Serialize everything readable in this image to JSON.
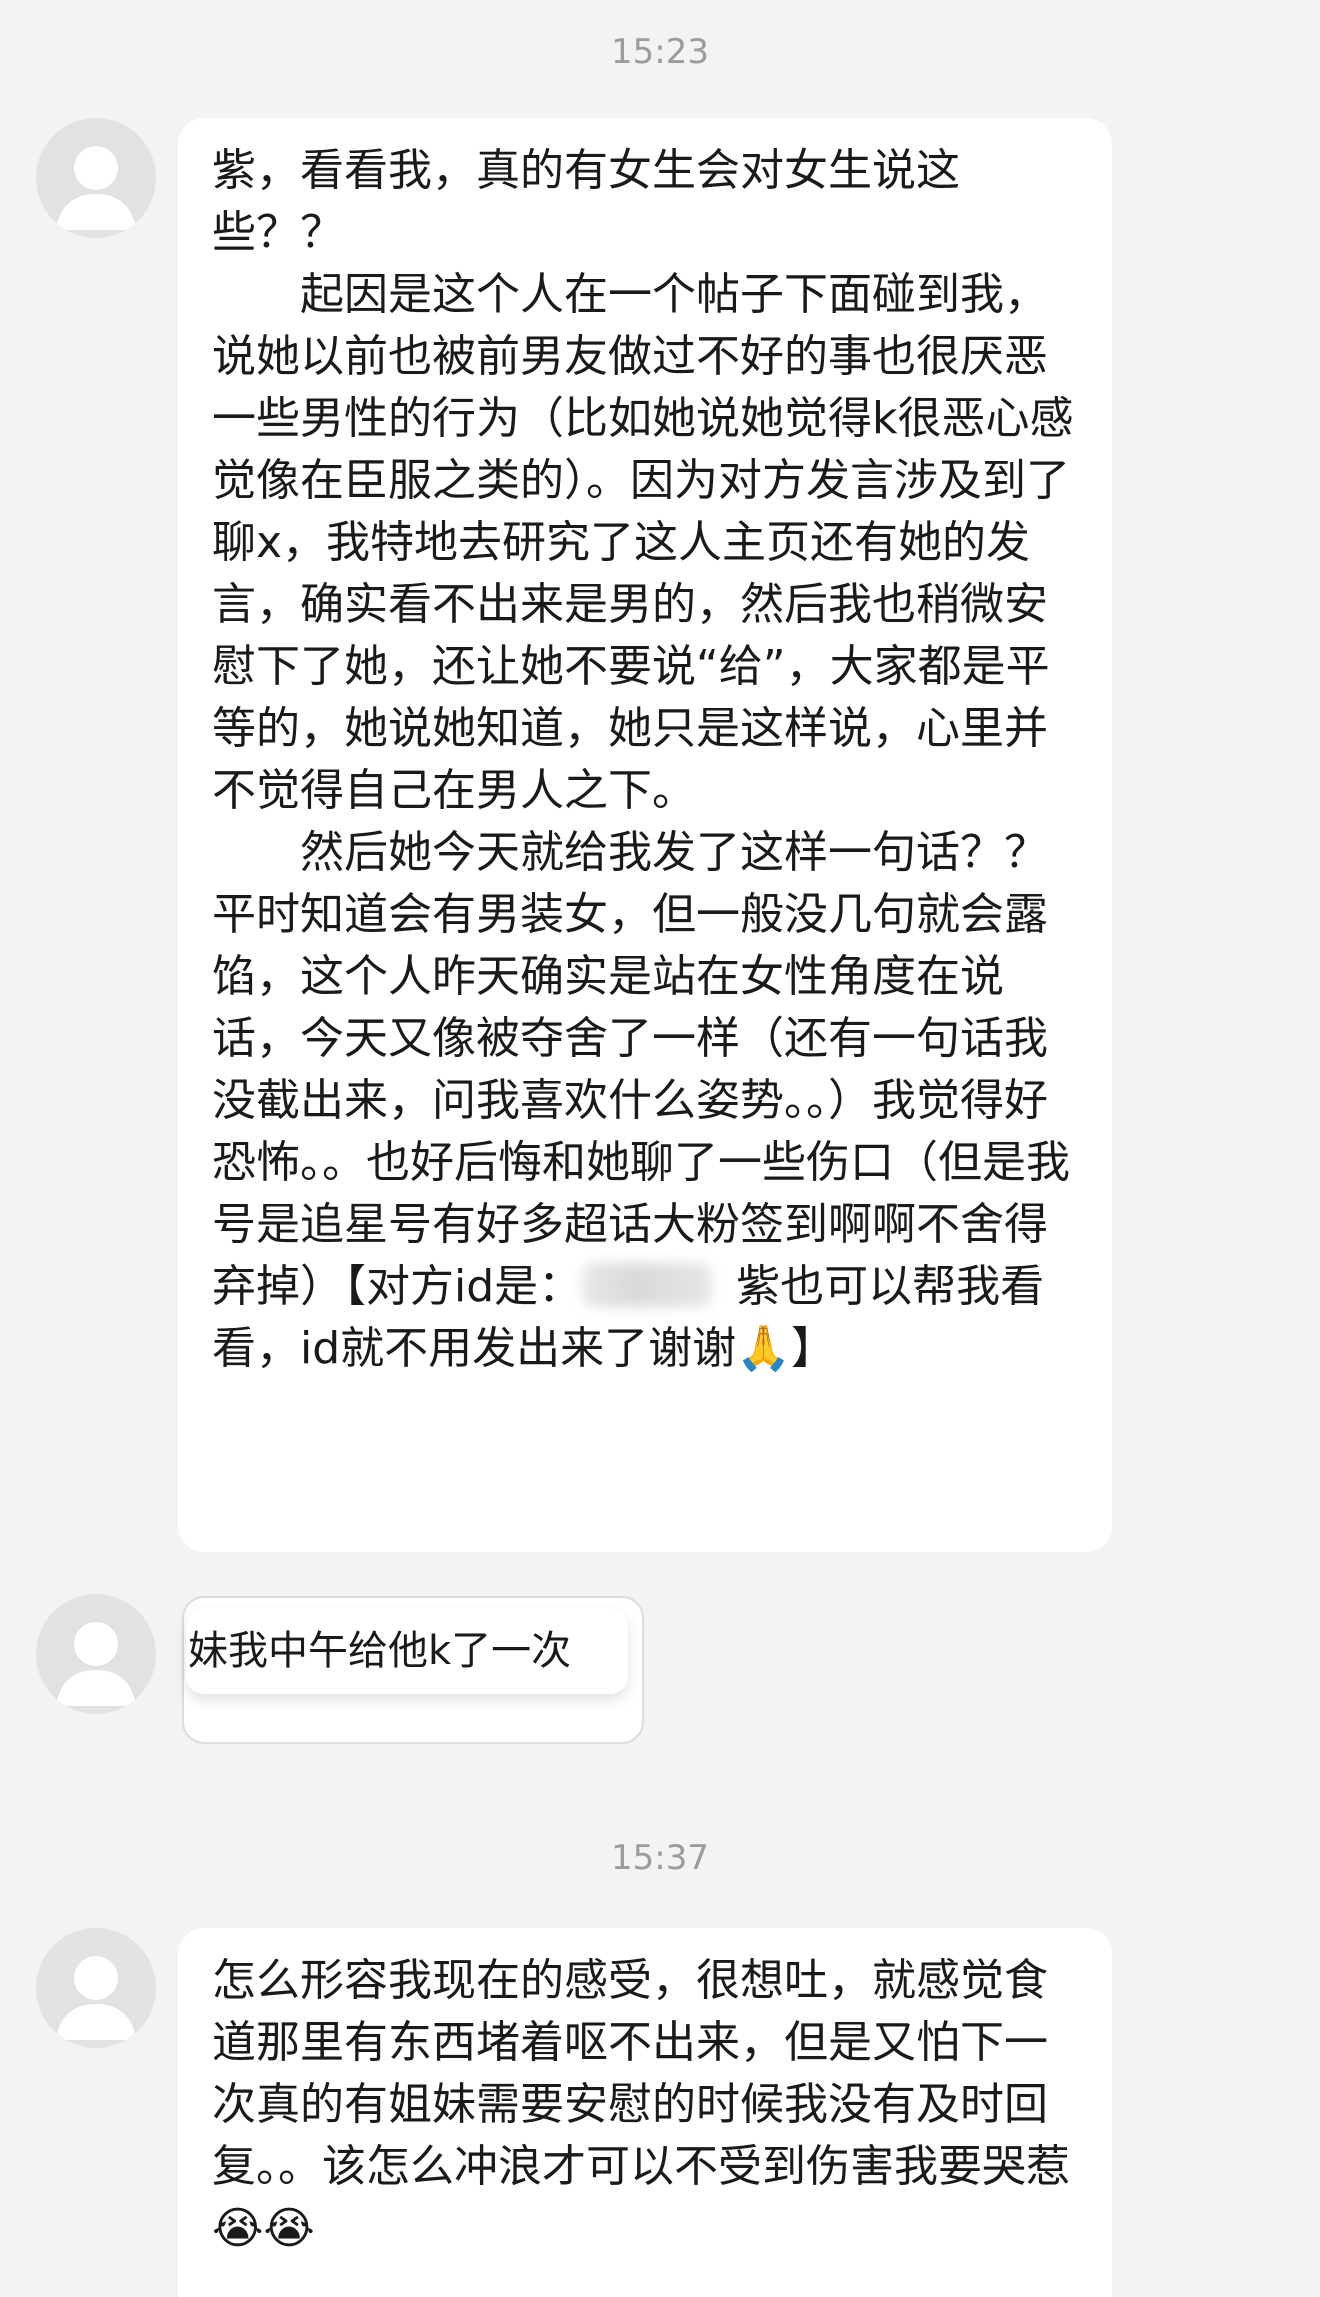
{
  "messages": [
    {
      "timestamp": "15:23",
      "bubble1": {
        "p1": "紫，看看我，真的有女生会对女生说这些？？",
        "p2": "起因是这个人在一个帖子下面碰到我，说她以前也被前男友做过不好的事也很厌恶一些男性的行为（比如她说她觉得k很恶心感觉像在臣服之类的）。因为对方发言涉及到了聊x，我特地去研究了这人主页还有她的发言，确实看不出来是男的，然后我也稍微安慰下了她，还让她不要说“给”，大家都是平等的，她说她知道，她只是这样说，心里并不觉得自己在男人之下。",
        "p3a": "然后她今天就给我发了这样一句话？？平时知道会有男装女，但一般没几句就会露馅，这个人昨天确实是站在女性角度在说话，今天又像被夺舍了一样（还有一句话我没截出来，问我喜欢什么姿势。。）我觉得好恐怖。。也好后悔和她聊了一些伤口（但是我号是追星号有好多超话大粉签到啊啊不舍得弃掉）【对方id是：",
        "p3b": "紫也可以帮我看看，id就不用发出来了谢谢",
        "p3c_emoji": "🙏",
        "p3c": "】"
      },
      "quote_text": "妹我中午给他k了一次"
    },
    {
      "timestamp": "15:37",
      "bubble2": {
        "text": "怎么形容我现在的感受，很想吐，就感觉食道那里有东西堵着呕不出来，但是又怕下一次真的有姐妹需要安慰的时候我没有及时回复。。该怎么冲浪才可以不受到伤害我要哭惹",
        "emojis": "😭😭"
      }
    }
  ]
}
